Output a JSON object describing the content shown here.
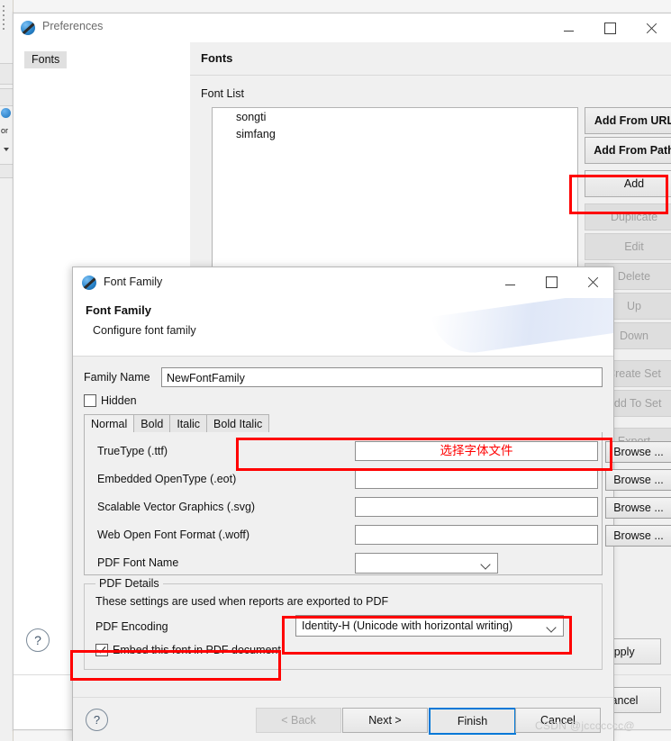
{
  "ide": {
    "label_fragment": "or"
  },
  "preferences": {
    "window_title": "Preferences",
    "icon": "birt-app-icon",
    "window_controls": {
      "minimize": "minimize-icon",
      "maximize": "maximize-icon",
      "close": "close-icon"
    },
    "tree": {
      "items": [
        "Fonts"
      ]
    },
    "page_title": "Fonts",
    "group_label": "Font List",
    "font_list": [
      "songti",
      "simfang"
    ],
    "side_buttons": [
      {
        "label": "Add From URL",
        "enabled": true,
        "bold": true
      },
      {
        "label": "Add From Path",
        "enabled": true,
        "bold": true
      },
      {
        "label": "Add",
        "enabled": true,
        "bold": true,
        "highlighted": true
      },
      {
        "label": "Duplicate",
        "enabled": false,
        "bold": false
      },
      {
        "label": "Edit",
        "enabled": false,
        "bold": false
      },
      {
        "label": "Delete",
        "enabled": false,
        "bold": false
      },
      {
        "label": "Up",
        "enabled": false,
        "bold": false
      },
      {
        "label": "Down",
        "enabled": false,
        "bold": false
      },
      {
        "label": "Create Set",
        "enabled": false,
        "bold": false
      },
      {
        "label": "Add To Set",
        "enabled": false,
        "bold": false
      },
      {
        "label": "Export",
        "enabled": false,
        "bold": false
      }
    ],
    "help_glyph": "?",
    "apply_label": "Apply",
    "cancel_label": "Cancel"
  },
  "font_family_dialog": {
    "window_title": "Font Family",
    "icon": "birt-app-icon",
    "window_controls": {
      "minimize": "minimize-icon",
      "maximize": "maximize-icon",
      "close": "close-icon"
    },
    "header_title": "Font Family",
    "header_subtitle": "Configure font family",
    "family_name": {
      "label": "Family Name",
      "value": "NewFontFamily"
    },
    "hidden_checkbox": {
      "label": "Hidden",
      "checked": false
    },
    "tabs": [
      {
        "label": "Normal",
        "active": true
      },
      {
        "label": "Bold",
        "active": false
      },
      {
        "label": "Italic",
        "active": false
      },
      {
        "label": "Bold Italic",
        "active": false
      }
    ],
    "file_rows": [
      {
        "label": "TrueType (.ttf)",
        "value": "选择字体文件",
        "annotated": true,
        "browse": "Browse ..."
      },
      {
        "label": "Embedded OpenType (.eot)",
        "value": "",
        "annotated": false,
        "browse": "Browse ..."
      },
      {
        "label": "Scalable Vector Graphics (.svg)",
        "value": "",
        "annotated": false,
        "browse": "Browse ..."
      },
      {
        "label": "Web Open Font Format (.woff)",
        "value": "",
        "annotated": false,
        "browse": "Browse ..."
      }
    ],
    "pdf_font_name": {
      "label": "PDF Font Name",
      "value": ""
    },
    "pdf_details": {
      "group_title": "PDF Details",
      "description": "These settings are used when reports are exported to PDF",
      "encoding_label": "PDF Encoding",
      "encoding_value": "Identity-H (Unicode with horizontal writing)",
      "embed_checkbox": {
        "label": "Embed this font in PDF document",
        "checked": true
      }
    },
    "footer": {
      "help_glyph": "?",
      "back_label": "< Back",
      "next_label": "Next >",
      "finish_label": "Finish",
      "cancel_label": "Cancel"
    }
  },
  "annotations": {
    "highlight_color": "#ff0000",
    "boxes": [
      {
        "name": "add-button-highlight"
      },
      {
        "name": "truetype-row-highlight"
      },
      {
        "name": "pdf-encoding-highlight"
      },
      {
        "name": "embed-font-highlight"
      }
    ]
  },
  "watermark": {
    "text": "CSDN @jccccccc@"
  }
}
